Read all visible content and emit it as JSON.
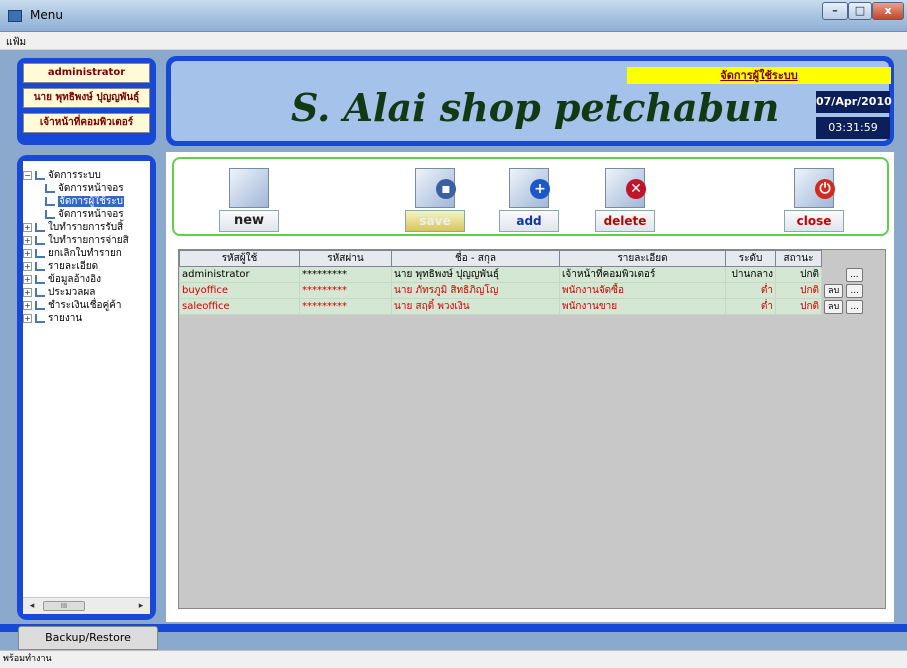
{
  "window": {
    "title": "Menu",
    "minimize": "–",
    "maximize": "□",
    "close": "x"
  },
  "menubar": {
    "file": "แฟ้ม"
  },
  "user": {
    "role": "administrator",
    "name": "นาย พุทธิพงษ์ ปุญญพันธุ์",
    "position": "เจ้าหน้าที่คอมพิวเตอร์"
  },
  "header": {
    "shop_name": "S. Alai shop petchabun",
    "page_title": "จัดการผู้ใช้ระบบ",
    "date": "07/Apr/2010",
    "time": "03:31:59"
  },
  "sidebar": {
    "items": [
      {
        "label": "จัดการระบบ",
        "toggle": "−",
        "level": 0
      },
      {
        "label": "จัดการหน้าจอร",
        "level": 1
      },
      {
        "label": "จัดการผู้ใช้ระบ",
        "level": 1,
        "selected": true
      },
      {
        "label": "จัดการหน้าจอร",
        "level": 1
      },
      {
        "label": "ใบทำรายการรับสิ้",
        "toggle": "+",
        "level": 0
      },
      {
        "label": "ใบทำรายการจ่ายสิ",
        "toggle": "+",
        "level": 0
      },
      {
        "label": "ยกเลิกใบทำรายก",
        "toggle": "+",
        "level": 0
      },
      {
        "label": "รายละเอียด",
        "toggle": "+",
        "level": 0
      },
      {
        "label": "ข้อมูลอ้างอิง",
        "toggle": "+",
        "level": 0
      },
      {
        "label": "ประมวลผล",
        "toggle": "+",
        "level": 0
      },
      {
        "label": "ชำระเงินเชื่อคู่ค้า",
        "toggle": "+",
        "level": 0
      },
      {
        "label": "รายงาน",
        "toggle": "+",
        "level": 0
      }
    ],
    "scroll_left": "◂",
    "scroll_right": "▸",
    "scroll_thumb": "III"
  },
  "toolbar": {
    "new": "new",
    "save": "save",
    "add": "add",
    "delete": "delete",
    "close": "close"
  },
  "grid": {
    "headers": [
      "รหัสผู้ใช้",
      "รหัสผ่าน",
      "ชื่อ - สกุล",
      "รายละเอียด",
      "ระดับ",
      "สถานะ"
    ],
    "rows": [
      [
        "administrator",
        "*********",
        "นาย พุทธิพงษ์ ปุญญพันธุ์",
        "เจ้าหน้าที่คอมพิวเตอร์",
        "ปานกลาง",
        "ปกติ"
      ],
      [
        "buyoffice",
        "*********",
        "นาย ภัทรภูมิ สิทธิภิญโญ",
        "พนักงานจัดซื้อ",
        "ต่ำ",
        "ปกติ"
      ],
      [
        "saleoffice",
        "*********",
        "นาย สฤติ์ พวงเงิน",
        "พนักงานขาย",
        "ต่ำ",
        "ปกติ"
      ]
    ],
    "delete_label": "ลบ",
    "more_label": "..."
  },
  "footer": {
    "backup_tab": "Backup/Restore"
  },
  "status": {
    "text": "พร้อมทำงาน"
  },
  "colors": {
    "frame_blue": "#1848d6",
    "header_bg": "#a4c2ea",
    "row_bg": "#d3e7d2",
    "accent_green": "#5fd04a"
  }
}
